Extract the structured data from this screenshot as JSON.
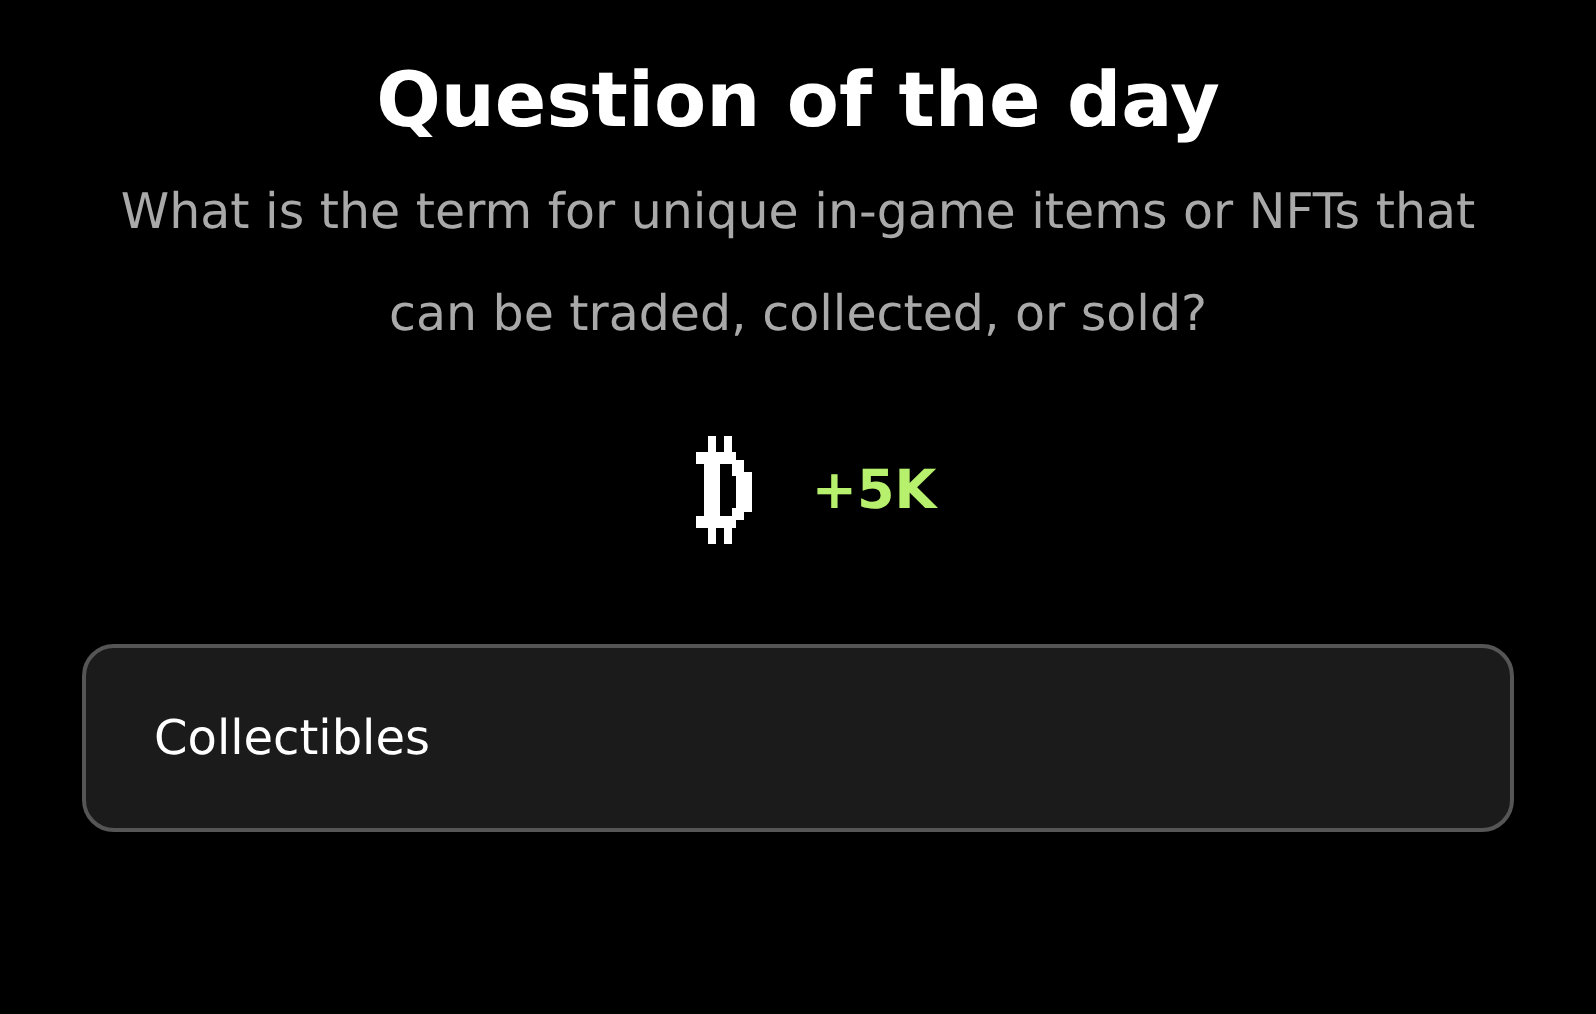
{
  "title": "Question of the day",
  "question": "What is the term for unique in-game items or NFTs that can be traded, collected, or sold?",
  "reward": {
    "amount": "+5K"
  },
  "options": [
    {
      "label": "Collectibles"
    }
  ]
}
